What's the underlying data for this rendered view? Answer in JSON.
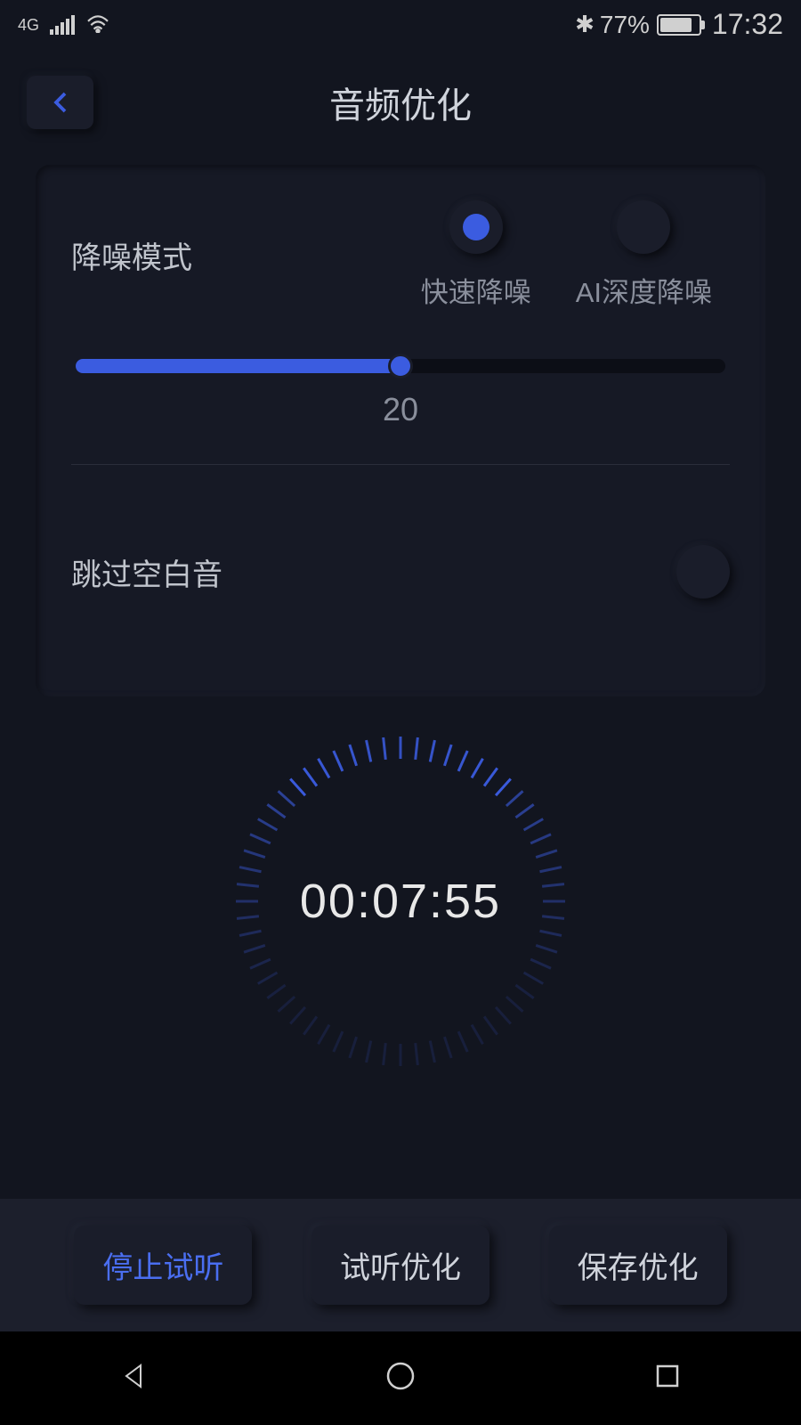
{
  "statusBar": {
    "network": "4G",
    "batteryPercent": "77%",
    "time": "17:32"
  },
  "header": {
    "title": "音频优化"
  },
  "panel": {
    "noiseReduction": {
      "label": "降噪模式",
      "options": {
        "fast": "快速降噪",
        "aiDeep": "AI深度降噪"
      },
      "sliderValue": "20"
    },
    "skipSilence": {
      "label": "跳过空白音"
    }
  },
  "timer": {
    "value": "00:07:55"
  },
  "actions": {
    "stopPreview": "停止试听",
    "previewOptimize": "试听优化",
    "saveOptimize": "保存优化"
  }
}
